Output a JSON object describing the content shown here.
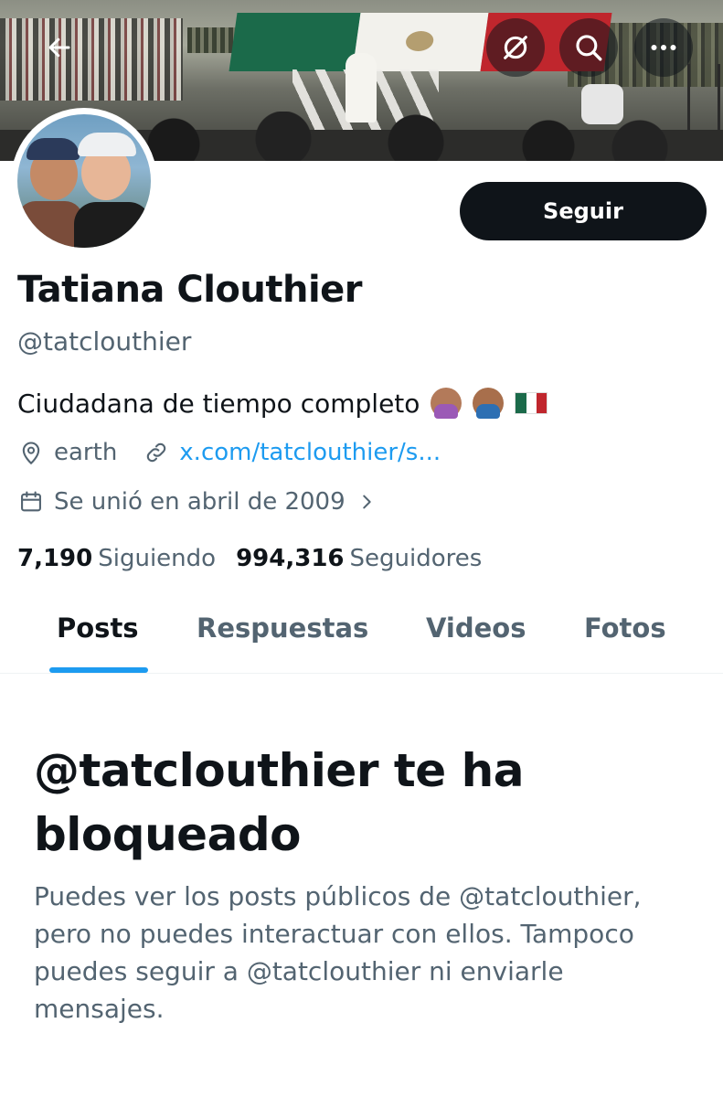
{
  "header": {
    "back_icon": "arrow-left-icon",
    "grok_icon": "slashed-circle-icon",
    "search_icon": "search-icon",
    "more_icon": "more-dots-icon"
  },
  "profile": {
    "name": "Tatiana Clouthier",
    "handle": "@tatclouthier",
    "bio": "Ciudadana de tiempo completo",
    "location": "earth",
    "website": "x.com/tatclouthier/s...",
    "joined": "Se unió en abril de 2009",
    "following_count": "7,190",
    "following_label": "Siguiendo",
    "followers_count": "994,316",
    "followers_label": "Seguidores",
    "follow_button": "Seguir"
  },
  "tabs": [
    {
      "label": "Posts",
      "active": true
    },
    {
      "label": "Respuestas",
      "active": false
    },
    {
      "label": "Videos",
      "active": false
    },
    {
      "label": "Fotos",
      "active": false
    }
  ],
  "blocked": {
    "title": "@tatclouthier te ha bloqueado",
    "description": "Puedes ver los posts públicos de @tatclouthier, pero no puedes interactuar con ellos. Tampoco puedes seguir a @tatclouthier ni enviarle mensajes."
  },
  "colors": {
    "accent": "#1d9bf0",
    "text": "#0f1419",
    "secondary": "#536471"
  }
}
